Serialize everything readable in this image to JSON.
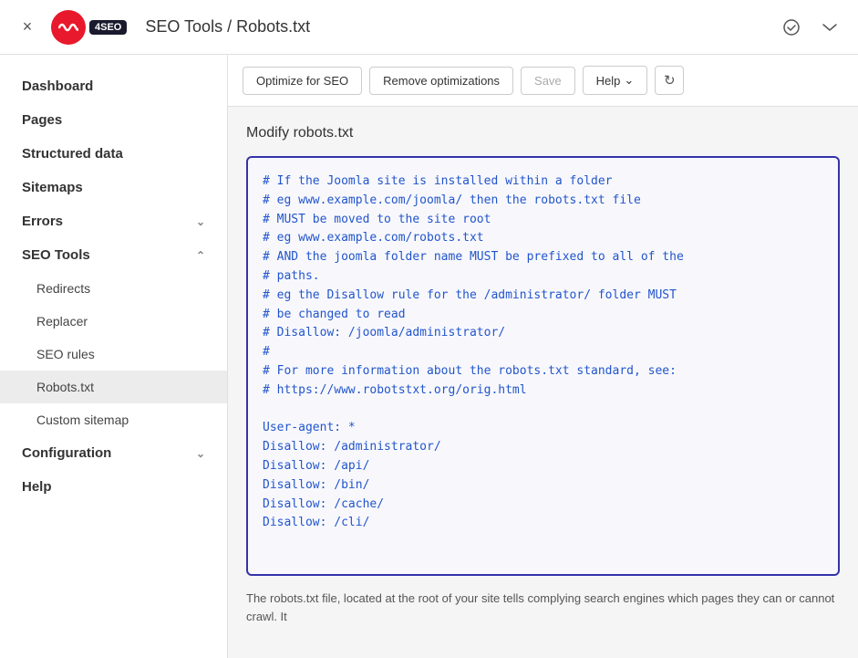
{
  "topbar": {
    "title": "SEO Tools / Robots.txt",
    "logo_text": "4SEO",
    "close_label": "×"
  },
  "toolbar": {
    "optimize_label": "Optimize for SEO",
    "remove_label": "Remove optimizations",
    "save_label": "Save",
    "help_label": "Help",
    "refresh_icon": "↻"
  },
  "sidebar": {
    "items": [
      {
        "label": "Dashboard",
        "level": "top",
        "active": false,
        "expandable": false
      },
      {
        "label": "Pages",
        "level": "top",
        "active": false,
        "expandable": false
      },
      {
        "label": "Structured data",
        "level": "top",
        "active": false,
        "expandable": false
      },
      {
        "label": "Sitemaps",
        "level": "top",
        "active": false,
        "expandable": false
      },
      {
        "label": "Errors",
        "level": "top",
        "active": false,
        "expandable": true,
        "expanded": false
      },
      {
        "label": "SEO Tools",
        "level": "top",
        "active": false,
        "expandable": true,
        "expanded": true
      },
      {
        "label": "Redirects",
        "level": "sub",
        "active": false
      },
      {
        "label": "Replacer",
        "level": "sub",
        "active": false
      },
      {
        "label": "SEO rules",
        "level": "sub",
        "active": false
      },
      {
        "label": "Robots.txt",
        "level": "sub",
        "active": true
      },
      {
        "label": "Custom sitemap",
        "level": "sub",
        "active": false
      },
      {
        "label": "Configuration",
        "level": "top",
        "active": false,
        "expandable": true,
        "expanded": false
      },
      {
        "label": "Help",
        "level": "top",
        "active": false,
        "expandable": false
      }
    ]
  },
  "content": {
    "section_title": "Modify robots.txt",
    "editor_lines": [
      "# If the Joomla site is installed within a folder",
      "# eg www.example.com/joomla/ then the robots.txt file",
      "# MUST be moved to the site root",
      "# eg www.example.com/robots.txt",
      "# AND the joomla folder name MUST be prefixed to all of the",
      "# paths.",
      "# eg the Disallow rule for the /administrator/ folder MUST",
      "# be changed to read",
      "# Disallow: /joomla/administrator/",
      "#",
      "# For more information about the robots.txt standard, see:",
      "# https://www.robotstxt.org/orig.html",
      "",
      "User-agent: *",
      "Disallow: /administrator/",
      "Disallow: /api/",
      "Disallow: /bin/",
      "Disallow: /cache/",
      "Disallow: /cli/"
    ],
    "description": "The robots.txt file, located at the root of your site tells complying search engines which pages they can or cannot crawl. It"
  }
}
